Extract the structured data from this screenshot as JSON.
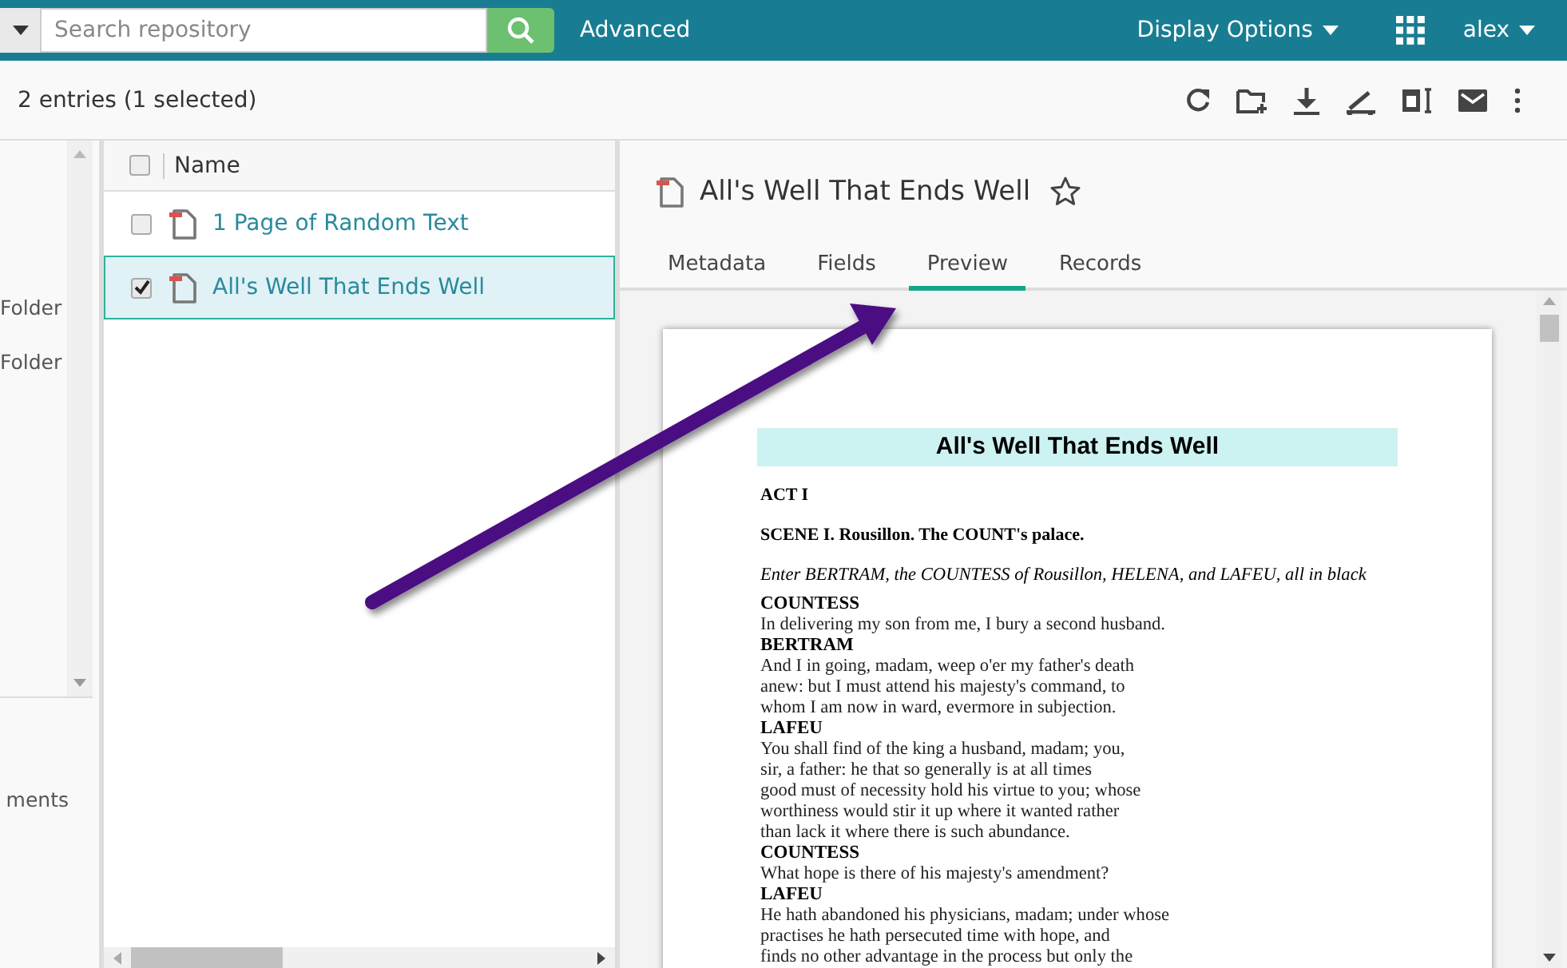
{
  "topbar": {
    "search": {
      "placeholder": "Search repository"
    },
    "advanced": "Advanced",
    "display_options": "Display Options",
    "user": "alex"
  },
  "toolbar": {
    "count": "2 entries (1 selected)"
  },
  "sidebar": {
    "items": [
      "Folder",
      "Folder"
    ],
    "footer": "ments"
  },
  "file_list": {
    "header": "Name",
    "header_checked": false,
    "rows": [
      {
        "name": "1 Page of Random Text",
        "checked": false,
        "selected": false
      },
      {
        "name": "All's Well That Ends Well",
        "checked": true,
        "selected": true
      }
    ]
  },
  "details": {
    "title": "All's Well That Ends Well",
    "starred": false,
    "tabs": [
      {
        "label": "Metadata",
        "selected": false
      },
      {
        "label": "Fields",
        "selected": false
      },
      {
        "label": "Preview",
        "selected": true
      },
      {
        "label": "Records",
        "selected": false
      }
    ],
    "preview": {
      "lines": [
        {
          "kind": "title",
          "text": "All's Well That Ends Well"
        },
        {
          "kind": "heading",
          "text": "ACT I"
        },
        {
          "kind": "heading",
          "text": "SCENE I. Rousillon. The COUNT's palace."
        },
        {
          "kind": "stage",
          "text": "Enter BERTRAM, the COUNTESS of Rousillon, HELENA, and LAFEU, all in black"
        },
        {
          "kind": "speaker",
          "text": "COUNTESS"
        },
        {
          "kind": "line",
          "text": "In delivering my son from me, I bury a second husband."
        },
        {
          "kind": "speaker",
          "text": "BERTRAM"
        },
        {
          "kind": "line",
          "text": "And I in going, madam, weep o'er my father's death"
        },
        {
          "kind": "line",
          "text": "anew: but I must attend his majesty's command, to"
        },
        {
          "kind": "line",
          "text": "whom I am now in ward, evermore in subjection."
        },
        {
          "kind": "speaker",
          "text": "LAFEU"
        },
        {
          "kind": "line",
          "text": "You shall find of the king a husband, madam; you,"
        },
        {
          "kind": "line",
          "text": "sir, a father: he that so generally is at all times"
        },
        {
          "kind": "line",
          "text": "good must of necessity hold his virtue to you; whose"
        },
        {
          "kind": "line",
          "text": "worthiness would stir it up where it wanted rather"
        },
        {
          "kind": "line",
          "text": "than lack it where there is such abundance."
        },
        {
          "kind": "speaker",
          "text": "COUNTESS"
        },
        {
          "kind": "line",
          "text": "What hope is there of his majesty's amendment?"
        },
        {
          "kind": "speaker",
          "text": "LAFEU"
        },
        {
          "kind": "line",
          "text": "He hath abandoned his physicians, madam; under whose"
        },
        {
          "kind": "line",
          "text": "practises he hath persecuted time with hope, and"
        },
        {
          "kind": "line",
          "text": "finds no other advantage in the process but only the"
        }
      ]
    }
  }
}
